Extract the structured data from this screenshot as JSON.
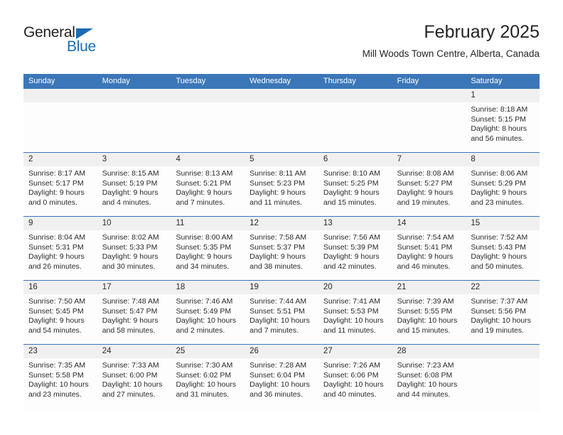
{
  "brand": {
    "name_top": "General",
    "name_bottom": "Blue",
    "color_blue": "#1b6cb3",
    "color_dark": "#231f20"
  },
  "header": {
    "title": "February 2025",
    "subtitle": "Mill Woods Town Centre, Alberta, Canada"
  },
  "theme": {
    "header_bar": "#3b77b8",
    "number_strip": "#f0f0f0",
    "row_rule": "#3b77b8"
  },
  "weekdays": [
    "Sunday",
    "Monday",
    "Tuesday",
    "Wednesday",
    "Thursday",
    "Friday",
    "Saturday"
  ],
  "weeks": [
    [
      {
        "day": "",
        "lines": []
      },
      {
        "day": "",
        "lines": []
      },
      {
        "day": "",
        "lines": []
      },
      {
        "day": "",
        "lines": []
      },
      {
        "day": "",
        "lines": []
      },
      {
        "day": "",
        "lines": []
      },
      {
        "day": "1",
        "lines": [
          "Sunrise: 8:18 AM",
          "Sunset: 5:15 PM",
          "Daylight: 8 hours",
          "and 56 minutes."
        ]
      }
    ],
    [
      {
        "day": "2",
        "lines": [
          "Sunrise: 8:17 AM",
          "Sunset: 5:17 PM",
          "Daylight: 9 hours",
          "and 0 minutes."
        ]
      },
      {
        "day": "3",
        "lines": [
          "Sunrise: 8:15 AM",
          "Sunset: 5:19 PM",
          "Daylight: 9 hours",
          "and 4 minutes."
        ]
      },
      {
        "day": "4",
        "lines": [
          "Sunrise: 8:13 AM",
          "Sunset: 5:21 PM",
          "Daylight: 9 hours",
          "and 7 minutes."
        ]
      },
      {
        "day": "5",
        "lines": [
          "Sunrise: 8:11 AM",
          "Sunset: 5:23 PM",
          "Daylight: 9 hours",
          "and 11 minutes."
        ]
      },
      {
        "day": "6",
        "lines": [
          "Sunrise: 8:10 AM",
          "Sunset: 5:25 PM",
          "Daylight: 9 hours",
          "and 15 minutes."
        ]
      },
      {
        "day": "7",
        "lines": [
          "Sunrise: 8:08 AM",
          "Sunset: 5:27 PM",
          "Daylight: 9 hours",
          "and 19 minutes."
        ]
      },
      {
        "day": "8",
        "lines": [
          "Sunrise: 8:06 AM",
          "Sunset: 5:29 PM",
          "Daylight: 9 hours",
          "and 23 minutes."
        ]
      }
    ],
    [
      {
        "day": "9",
        "lines": [
          "Sunrise: 8:04 AM",
          "Sunset: 5:31 PM",
          "Daylight: 9 hours",
          "and 26 minutes."
        ]
      },
      {
        "day": "10",
        "lines": [
          "Sunrise: 8:02 AM",
          "Sunset: 5:33 PM",
          "Daylight: 9 hours",
          "and 30 minutes."
        ]
      },
      {
        "day": "11",
        "lines": [
          "Sunrise: 8:00 AM",
          "Sunset: 5:35 PM",
          "Daylight: 9 hours",
          "and 34 minutes."
        ]
      },
      {
        "day": "12",
        "lines": [
          "Sunrise: 7:58 AM",
          "Sunset: 5:37 PM",
          "Daylight: 9 hours",
          "and 38 minutes."
        ]
      },
      {
        "day": "13",
        "lines": [
          "Sunrise: 7:56 AM",
          "Sunset: 5:39 PM",
          "Daylight: 9 hours",
          "and 42 minutes."
        ]
      },
      {
        "day": "14",
        "lines": [
          "Sunrise: 7:54 AM",
          "Sunset: 5:41 PM",
          "Daylight: 9 hours",
          "and 46 minutes."
        ]
      },
      {
        "day": "15",
        "lines": [
          "Sunrise: 7:52 AM",
          "Sunset: 5:43 PM",
          "Daylight: 9 hours",
          "and 50 minutes."
        ]
      }
    ],
    [
      {
        "day": "16",
        "lines": [
          "Sunrise: 7:50 AM",
          "Sunset: 5:45 PM",
          "Daylight: 9 hours",
          "and 54 minutes."
        ]
      },
      {
        "day": "17",
        "lines": [
          "Sunrise: 7:48 AM",
          "Sunset: 5:47 PM",
          "Daylight: 9 hours",
          "and 58 minutes."
        ]
      },
      {
        "day": "18",
        "lines": [
          "Sunrise: 7:46 AM",
          "Sunset: 5:49 PM",
          "Daylight: 10 hours",
          "and 2 minutes."
        ]
      },
      {
        "day": "19",
        "lines": [
          "Sunrise: 7:44 AM",
          "Sunset: 5:51 PM",
          "Daylight: 10 hours",
          "and 7 minutes."
        ]
      },
      {
        "day": "20",
        "lines": [
          "Sunrise: 7:41 AM",
          "Sunset: 5:53 PM",
          "Daylight: 10 hours",
          "and 11 minutes."
        ]
      },
      {
        "day": "21",
        "lines": [
          "Sunrise: 7:39 AM",
          "Sunset: 5:55 PM",
          "Daylight: 10 hours",
          "and 15 minutes."
        ]
      },
      {
        "day": "22",
        "lines": [
          "Sunrise: 7:37 AM",
          "Sunset: 5:56 PM",
          "Daylight: 10 hours",
          "and 19 minutes."
        ]
      }
    ],
    [
      {
        "day": "23",
        "lines": [
          "Sunrise: 7:35 AM",
          "Sunset: 5:58 PM",
          "Daylight: 10 hours",
          "and 23 minutes."
        ]
      },
      {
        "day": "24",
        "lines": [
          "Sunrise: 7:33 AM",
          "Sunset: 6:00 PM",
          "Daylight: 10 hours",
          "and 27 minutes."
        ]
      },
      {
        "day": "25",
        "lines": [
          "Sunrise: 7:30 AM",
          "Sunset: 6:02 PM",
          "Daylight: 10 hours",
          "and 31 minutes."
        ]
      },
      {
        "day": "26",
        "lines": [
          "Sunrise: 7:28 AM",
          "Sunset: 6:04 PM",
          "Daylight: 10 hours",
          "and 36 minutes."
        ]
      },
      {
        "day": "27",
        "lines": [
          "Sunrise: 7:26 AM",
          "Sunset: 6:06 PM",
          "Daylight: 10 hours",
          "and 40 minutes."
        ]
      },
      {
        "day": "28",
        "lines": [
          "Sunrise: 7:23 AM",
          "Sunset: 6:08 PM",
          "Daylight: 10 hours",
          "and 44 minutes."
        ]
      },
      {
        "day": "",
        "lines": []
      }
    ]
  ]
}
